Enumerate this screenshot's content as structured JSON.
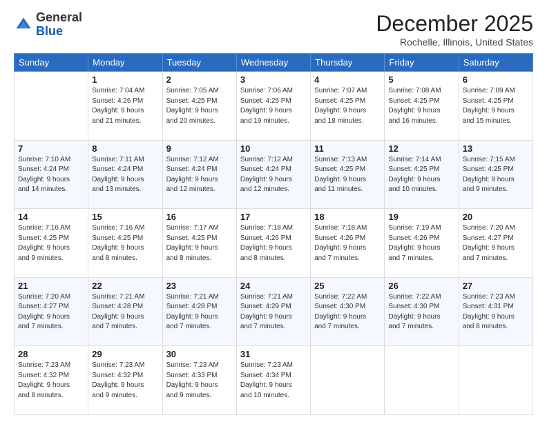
{
  "header": {
    "logo_general": "General",
    "logo_blue": "Blue",
    "month_title": "December 2025",
    "location": "Rochelle, Illinois, United States"
  },
  "days_of_week": [
    "Sunday",
    "Monday",
    "Tuesday",
    "Wednesday",
    "Thursday",
    "Friday",
    "Saturday"
  ],
  "weeks": [
    [
      {
        "day": "",
        "info": ""
      },
      {
        "day": "1",
        "info": "Sunrise: 7:04 AM\nSunset: 4:26 PM\nDaylight: 9 hours\nand 21 minutes."
      },
      {
        "day": "2",
        "info": "Sunrise: 7:05 AM\nSunset: 4:25 PM\nDaylight: 9 hours\nand 20 minutes."
      },
      {
        "day": "3",
        "info": "Sunrise: 7:06 AM\nSunset: 4:25 PM\nDaylight: 9 hours\nand 19 minutes."
      },
      {
        "day": "4",
        "info": "Sunrise: 7:07 AM\nSunset: 4:25 PM\nDaylight: 9 hours\nand 18 minutes."
      },
      {
        "day": "5",
        "info": "Sunrise: 7:08 AM\nSunset: 4:25 PM\nDaylight: 9 hours\nand 16 minutes."
      },
      {
        "day": "6",
        "info": "Sunrise: 7:09 AM\nSunset: 4:25 PM\nDaylight: 9 hours\nand 15 minutes."
      }
    ],
    [
      {
        "day": "7",
        "info": "Sunrise: 7:10 AM\nSunset: 4:24 PM\nDaylight: 9 hours\nand 14 minutes."
      },
      {
        "day": "8",
        "info": "Sunrise: 7:11 AM\nSunset: 4:24 PM\nDaylight: 9 hours\nand 13 minutes."
      },
      {
        "day": "9",
        "info": "Sunrise: 7:12 AM\nSunset: 4:24 PM\nDaylight: 9 hours\nand 12 minutes."
      },
      {
        "day": "10",
        "info": "Sunrise: 7:12 AM\nSunset: 4:24 PM\nDaylight: 9 hours\nand 12 minutes."
      },
      {
        "day": "11",
        "info": "Sunrise: 7:13 AM\nSunset: 4:25 PM\nDaylight: 9 hours\nand 11 minutes."
      },
      {
        "day": "12",
        "info": "Sunrise: 7:14 AM\nSunset: 4:25 PM\nDaylight: 9 hours\nand 10 minutes."
      },
      {
        "day": "13",
        "info": "Sunrise: 7:15 AM\nSunset: 4:25 PM\nDaylight: 9 hours\nand 9 minutes."
      }
    ],
    [
      {
        "day": "14",
        "info": "Sunrise: 7:16 AM\nSunset: 4:25 PM\nDaylight: 9 hours\nand 9 minutes."
      },
      {
        "day": "15",
        "info": "Sunrise: 7:16 AM\nSunset: 4:25 PM\nDaylight: 9 hours\nand 8 minutes."
      },
      {
        "day": "16",
        "info": "Sunrise: 7:17 AM\nSunset: 4:25 PM\nDaylight: 9 hours\nand 8 minutes."
      },
      {
        "day": "17",
        "info": "Sunrise: 7:18 AM\nSunset: 4:26 PM\nDaylight: 9 hours\nand 8 minutes."
      },
      {
        "day": "18",
        "info": "Sunrise: 7:18 AM\nSunset: 4:26 PM\nDaylight: 9 hours\nand 7 minutes."
      },
      {
        "day": "19",
        "info": "Sunrise: 7:19 AM\nSunset: 4:26 PM\nDaylight: 9 hours\nand 7 minutes."
      },
      {
        "day": "20",
        "info": "Sunrise: 7:20 AM\nSunset: 4:27 PM\nDaylight: 9 hours\nand 7 minutes."
      }
    ],
    [
      {
        "day": "21",
        "info": "Sunrise: 7:20 AM\nSunset: 4:27 PM\nDaylight: 9 hours\nand 7 minutes."
      },
      {
        "day": "22",
        "info": "Sunrise: 7:21 AM\nSunset: 4:28 PM\nDaylight: 9 hours\nand 7 minutes."
      },
      {
        "day": "23",
        "info": "Sunrise: 7:21 AM\nSunset: 4:28 PM\nDaylight: 9 hours\nand 7 minutes."
      },
      {
        "day": "24",
        "info": "Sunrise: 7:21 AM\nSunset: 4:29 PM\nDaylight: 9 hours\nand 7 minutes."
      },
      {
        "day": "25",
        "info": "Sunrise: 7:22 AM\nSunset: 4:30 PM\nDaylight: 9 hours\nand 7 minutes."
      },
      {
        "day": "26",
        "info": "Sunrise: 7:22 AM\nSunset: 4:30 PM\nDaylight: 9 hours\nand 7 minutes."
      },
      {
        "day": "27",
        "info": "Sunrise: 7:23 AM\nSunset: 4:31 PM\nDaylight: 9 hours\nand 8 minutes."
      }
    ],
    [
      {
        "day": "28",
        "info": "Sunrise: 7:23 AM\nSunset: 4:32 PM\nDaylight: 9 hours\nand 8 minutes."
      },
      {
        "day": "29",
        "info": "Sunrise: 7:23 AM\nSunset: 4:32 PM\nDaylight: 9 hours\nand 9 minutes."
      },
      {
        "day": "30",
        "info": "Sunrise: 7:23 AM\nSunset: 4:33 PM\nDaylight: 9 hours\nand 9 minutes."
      },
      {
        "day": "31",
        "info": "Sunrise: 7:23 AM\nSunset: 4:34 PM\nDaylight: 9 hours\nand 10 minutes."
      },
      {
        "day": "",
        "info": ""
      },
      {
        "day": "",
        "info": ""
      },
      {
        "day": "",
        "info": ""
      }
    ]
  ]
}
